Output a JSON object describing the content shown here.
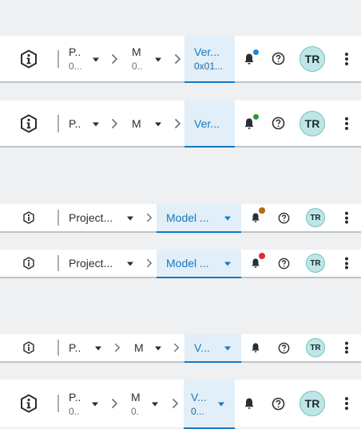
{
  "colors": {
    "accent": "#1478be",
    "notify_blue": "#1a86d6",
    "notify_green": "#2a9a3a",
    "notify_orange": "#b06a12",
    "notify_red": "#e52b2b",
    "avatar_bg": "#bfe6e7"
  },
  "bars": [
    {
      "project_label": "P..",
      "project_sub": "0...",
      "model_label": "M",
      "model_sub": "0..",
      "version_label": "Ver...",
      "version_sub": "0x01...",
      "avatar": "TR",
      "notification": "blue"
    },
    {
      "project_label": "P..",
      "model_label": "M",
      "version_label": "Ver...",
      "avatar": "TR",
      "notification": "green"
    },
    {
      "project_label": "Project...",
      "model_label": "Model ...",
      "avatar": "TR",
      "notification": "orange"
    },
    {
      "project_label": "Project...",
      "model_label": "Model ...",
      "avatar": "TR",
      "notification": "red"
    },
    {
      "project_label": "P..",
      "model_label": "M",
      "version_label": "V...",
      "avatar": "TR",
      "notification": "none"
    },
    {
      "project_label": "P..",
      "project_sub": "0..",
      "model_label": "M",
      "model_sub": "0.",
      "version_label": "V...",
      "version_sub": "0...",
      "avatar": "TR",
      "notification": "none"
    }
  ]
}
